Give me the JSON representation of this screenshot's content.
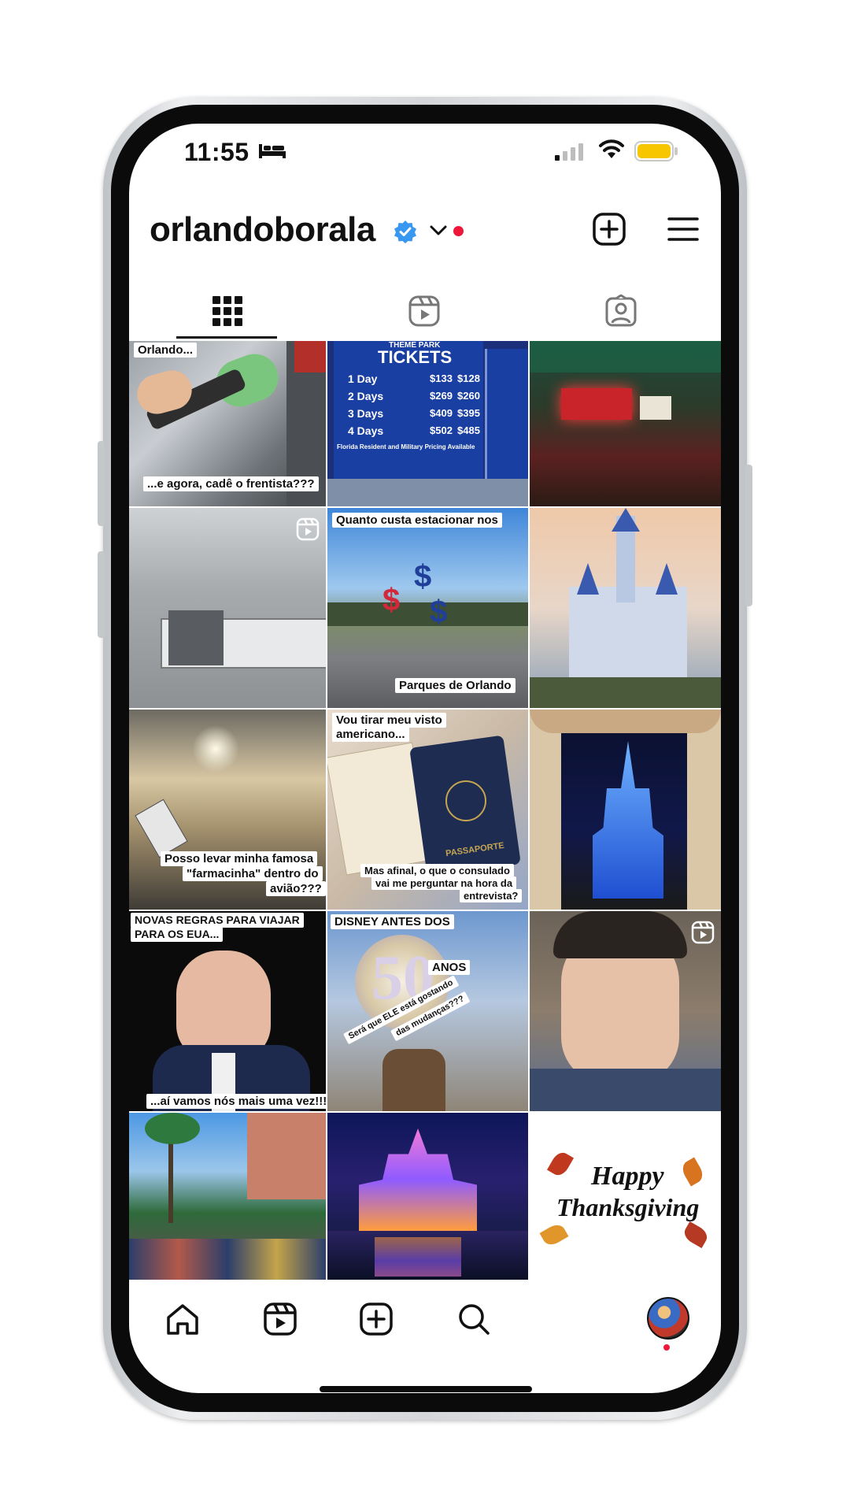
{
  "status_bar": {
    "time": "11:55"
  },
  "header": {
    "username": "orlandoborala"
  },
  "icons": {
    "verified": "verified-badge-icon",
    "dropdown": "chevron-down-icon",
    "notification": "red-dot",
    "create": "plus-square-icon",
    "menu": "hamburger-menu-icon",
    "tab_grid": "grid-icon",
    "tab_reels": "reels-icon",
    "tab_tagged": "tagged-person-icon",
    "nav_home": "home-icon",
    "nav_reels": "reels-icon",
    "nav_create": "plus-square-icon",
    "nav_search": "search-icon"
  },
  "colors": {
    "verified": "#3897f0",
    "notification_dot": "#ef1739",
    "text": "#111111"
  },
  "grid": {
    "posts": [
      {
        "captions": [
          "Orlando...",
          "...e agora, cadê o frentista???"
        ],
        "reel": false
      },
      {
        "captions": [
          "THEME PARK",
          "TICKETS",
          "1 Day",
          "$133",
          "$128",
          "2 Days",
          "$269",
          "$260",
          "3 Days",
          "$409",
          "$395",
          "4 Days",
          "$502",
          "$485",
          "Florida Resident and Military Pricing Available"
        ],
        "reel": false
      },
      {
        "captions": [],
        "reel": false
      },
      {
        "captions": [],
        "reel": true
      },
      {
        "captions": [
          "Quanto custa estacionar nos",
          "Parques de Orlando"
        ],
        "reel": false
      },
      {
        "captions": [],
        "reel": false
      },
      {
        "captions": [
          "Posso levar minha famosa",
          "\"farmacinha\" dentro do",
          "avião???"
        ],
        "reel": false
      },
      {
        "captions": [
          "Vou tirar meu visto",
          "americano...",
          "Mas afinal, o que o consulado",
          "vai me perguntar na hora da",
          "entrevista?",
          "PASSAPORTE"
        ],
        "reel": false
      },
      {
        "captions": [],
        "reel": false
      },
      {
        "captions": [
          "NOVAS REGRAS PARA VIAJAR",
          "PARA OS EUA...",
          "...aí vamos nós mais uma vez!!!"
        ],
        "reel": false
      },
      {
        "captions": [
          "DISNEY ANTES DOS",
          "50",
          "ANOS",
          "Será que ELE está gostando",
          "das mudanças???"
        ],
        "reel": false
      },
      {
        "captions": [],
        "reel": true
      },
      {
        "captions": [],
        "reel": false
      },
      {
        "captions": [],
        "reel": false
      },
      {
        "captions": [
          "Happy",
          "Thanksgiving"
        ],
        "reel": false
      }
    ]
  }
}
